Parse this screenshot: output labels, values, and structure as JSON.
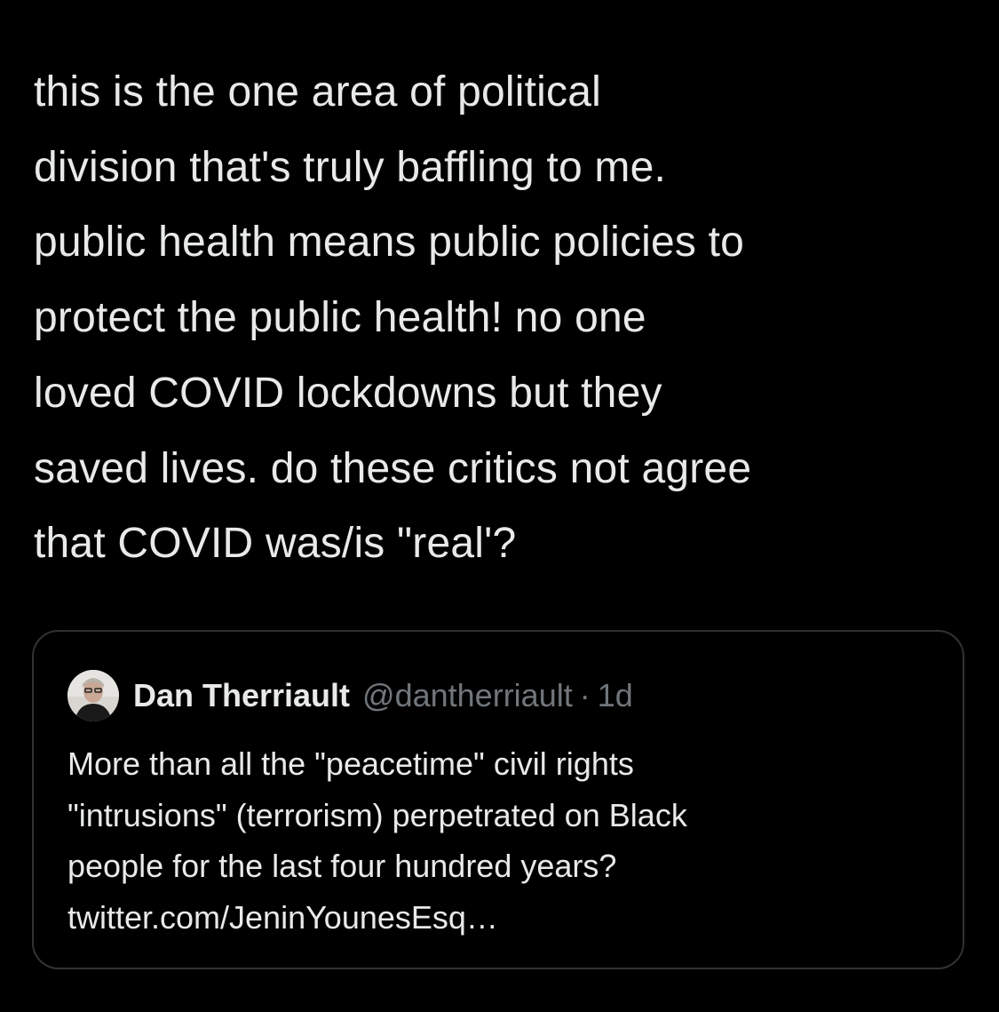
{
  "tweet": {
    "text_lines": [
      "this is the one area of political",
      "division that's truly baffling to me.",
      "public health means public policies to",
      "protect the public health! no one",
      "loved COVID lockdowns but they",
      "saved lives. do these critics not agree",
      "that COVID was/is \"real'?"
    ]
  },
  "quoted_tweet": {
    "author_name": "Dan Therriault",
    "author_handle": "@dantherriault",
    "separator": "·",
    "time": "1d",
    "avatar_icon": "user-avatar",
    "text_lines": [
      "More than all the \"peacetime\" civil rights",
      "\"intrusions\" (terrorism)  perpetrated on Black",
      "people for the last four hundred years?",
      "twitter.com/JeninYounesEsq…"
    ]
  },
  "colors": {
    "background": "#000000",
    "primary_text": "#e7e9ea",
    "secondary_text": "#71767b",
    "card_border": "#2f3336"
  }
}
